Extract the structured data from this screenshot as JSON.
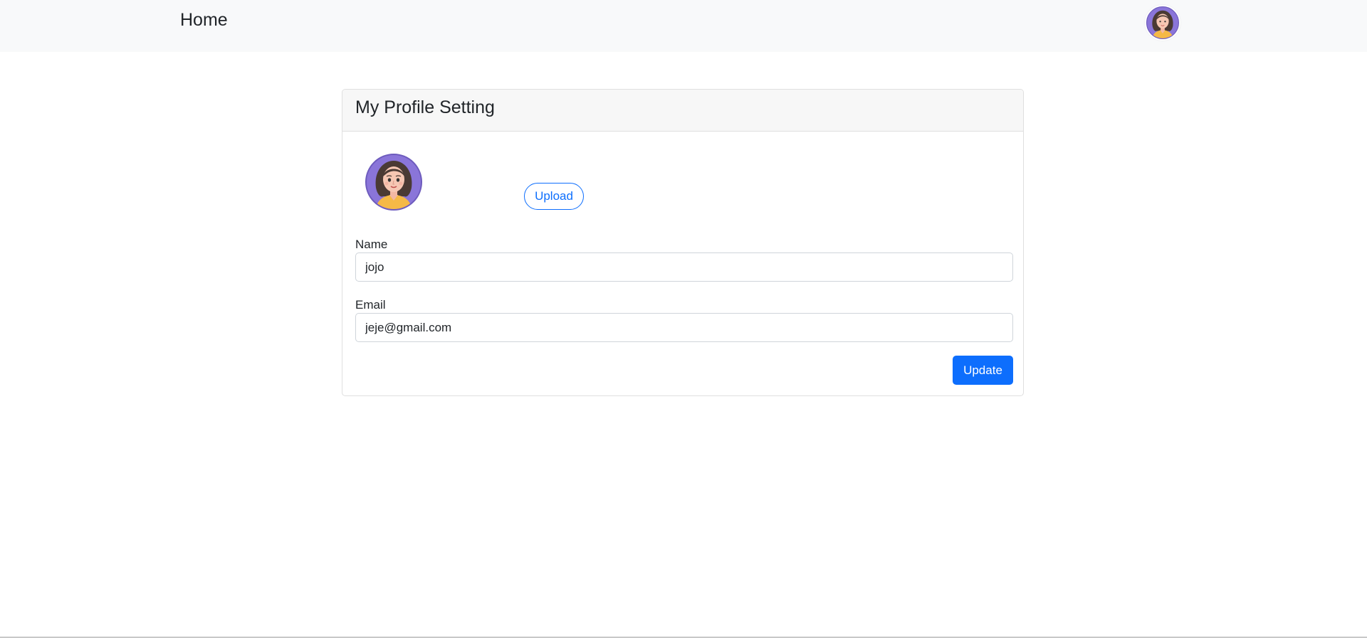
{
  "navbar": {
    "brand": "Home",
    "avatar_icon": "user-avatar-icon"
  },
  "card": {
    "title": "My Profile Setting",
    "avatar_icon": "woman-avatar-icon",
    "upload_label": "Upload",
    "name_label": "Name",
    "name_value": "jojo",
    "email_label": "Email",
    "email_value": "jeje@gmail.com",
    "update_label": "Update"
  },
  "colors": {
    "primary": "#0d6efd",
    "navbar_bg": "#f8f9fa",
    "card_header_bg": "#f7f7f7",
    "avatar_bg": "#8a75d9",
    "hair": "#4a3a34",
    "skin": "#f6c7b3",
    "shirt": "#f5b946"
  }
}
